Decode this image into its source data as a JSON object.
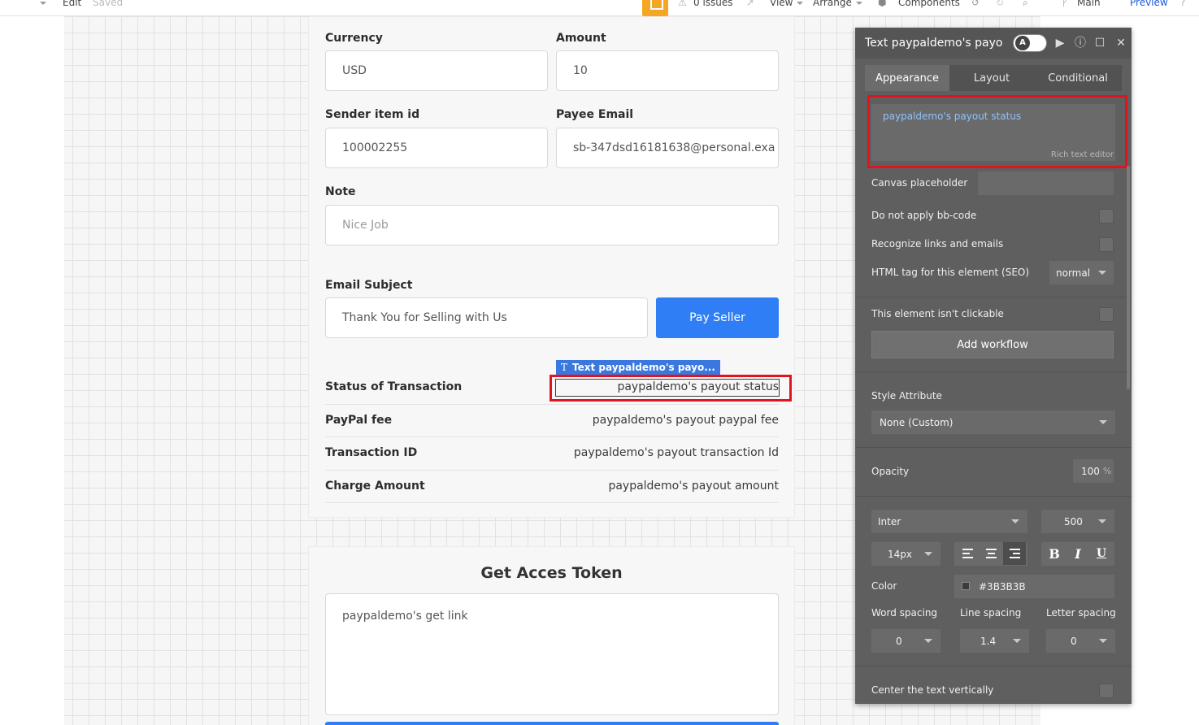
{
  "topbar": {
    "edit": "Edit",
    "saved": "Saved",
    "issues": "0 issues",
    "view": "View",
    "arrange": "Arrange",
    "components": "Components",
    "main": "Main",
    "preview": "Preview"
  },
  "form": {
    "currency_label": "Currency",
    "currency_value": "USD",
    "amount_label": "Amount",
    "amount_value": "10",
    "sender_label": "Sender item id",
    "sender_value": "100002255",
    "payee_label": "Payee Email",
    "payee_value": "sb-347dsd16181638@personal.exa",
    "note_label": "Note",
    "note_placeholder": "Nice Job",
    "subject_label": "Email Subject",
    "subject_placeholder": "Thank You for Selling with Us",
    "pay_button": "Pay Seller"
  },
  "selection": {
    "tag": "Text paypaldemo's payo...",
    "tag_icon": "T"
  },
  "status_rows": [
    {
      "label": "Status of Transaction",
      "value": "paypaldemo's payout status"
    },
    {
      "label": "PayPal fee",
      "value": "paypaldemo's payout paypal fee"
    },
    {
      "label": "Transaction ID",
      "value": "paypaldemo's payout transaction Id"
    },
    {
      "label": "Charge Amount",
      "value": "paypaldemo's payout amount"
    }
  ],
  "token": {
    "title": "Get Acces Token",
    "link_text": "paypaldemo's get link"
  },
  "panel": {
    "title": "Text paypaldemo's payo",
    "toggle_letter": "A",
    "tabs": [
      "Appearance",
      "Layout",
      "Conditional"
    ],
    "rte_text": "paypaldemo's payout status",
    "rte_hint": "Rich text editor",
    "canvas_placeholder": "Canvas placeholder",
    "no_bbcode": "Do not apply bb-code",
    "recognize_links": "Recognize links and emails",
    "html_tag_label": "HTML tag for this element (SEO)",
    "html_tag_value": "normal",
    "not_clickable": "This element isn't clickable",
    "add_workflow": "Add workflow",
    "style_label": "Style Attribute",
    "style_value": "None (Custom)",
    "opacity_label": "Opacity",
    "opacity_value": "100",
    "opacity_unit": "%",
    "font_family": "Inter",
    "font_weight": "500",
    "font_size": "14px",
    "color_label": "Color",
    "color_value": "#3B3B3B",
    "word_spacing_label": "Word spacing",
    "line_spacing_label": "Line spacing",
    "letter_spacing_label": "Letter spacing",
    "word_spacing": "0",
    "line_spacing": "1.4",
    "letter_spacing": "0",
    "center_vertical": "Center the text vertically",
    "bold": "B",
    "italic": "I",
    "underline": "U"
  },
  "colors": {
    "accent": "#2f7ef5",
    "highlight": "#e0141e",
    "panel_bg": "#5f5f5f"
  }
}
